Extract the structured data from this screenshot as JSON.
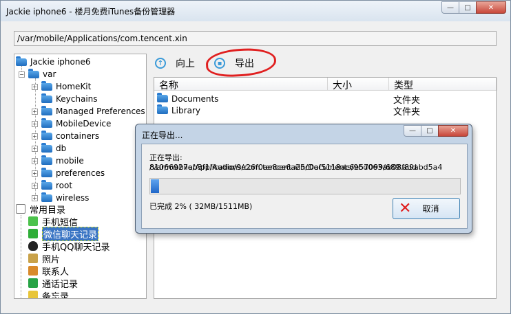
{
  "window": {
    "title": "Jackie iphone6 - 楼月免费iTunes备份管理器",
    "path": "/var/mobile/Applications/com.tencent.xin",
    "min_glyph": "—",
    "max_glyph": "□",
    "close_glyph": "✕"
  },
  "tree": {
    "root": "Jackie iphone6",
    "var": "var",
    "children": [
      "HomeKit",
      "Keychains",
      "Managed Preferences",
      "MobileDevice",
      "containers",
      "db",
      "mobile",
      "preferences",
      "root",
      "wireless"
    ],
    "categories_header": "常用目录",
    "categories": [
      "手机短信",
      "微信聊天记录",
      "手机QQ聊天记录",
      "照片",
      "联系人",
      "通话记录",
      "备忘录"
    ]
  },
  "toolbar": {
    "up_label": "向上",
    "export_label": "导出"
  },
  "listview": {
    "columns": [
      "名称",
      "大小",
      "类型"
    ],
    "rows": [
      {
        "name": "Documents",
        "size": "",
        "type": "文件夹"
      },
      {
        "name": "Library",
        "size": "",
        "type": "文件夹"
      }
    ]
  },
  "dialog": {
    "title": "正在导出...",
    "status_line1": "正在导出: /var/mobile/Applications/com.tencent.xin/Documents/9bd063ab08f89abd5a4",
    "status_line2": "81066927ab3f1/Audio/9e26f0ae8ce6a25c0af5118ac6e57099/689.aud",
    "progress_fraction": 0.02,
    "done_text": "已完成 2% ( 32MB/1511MB)",
    "cancel_label": "取消"
  }
}
